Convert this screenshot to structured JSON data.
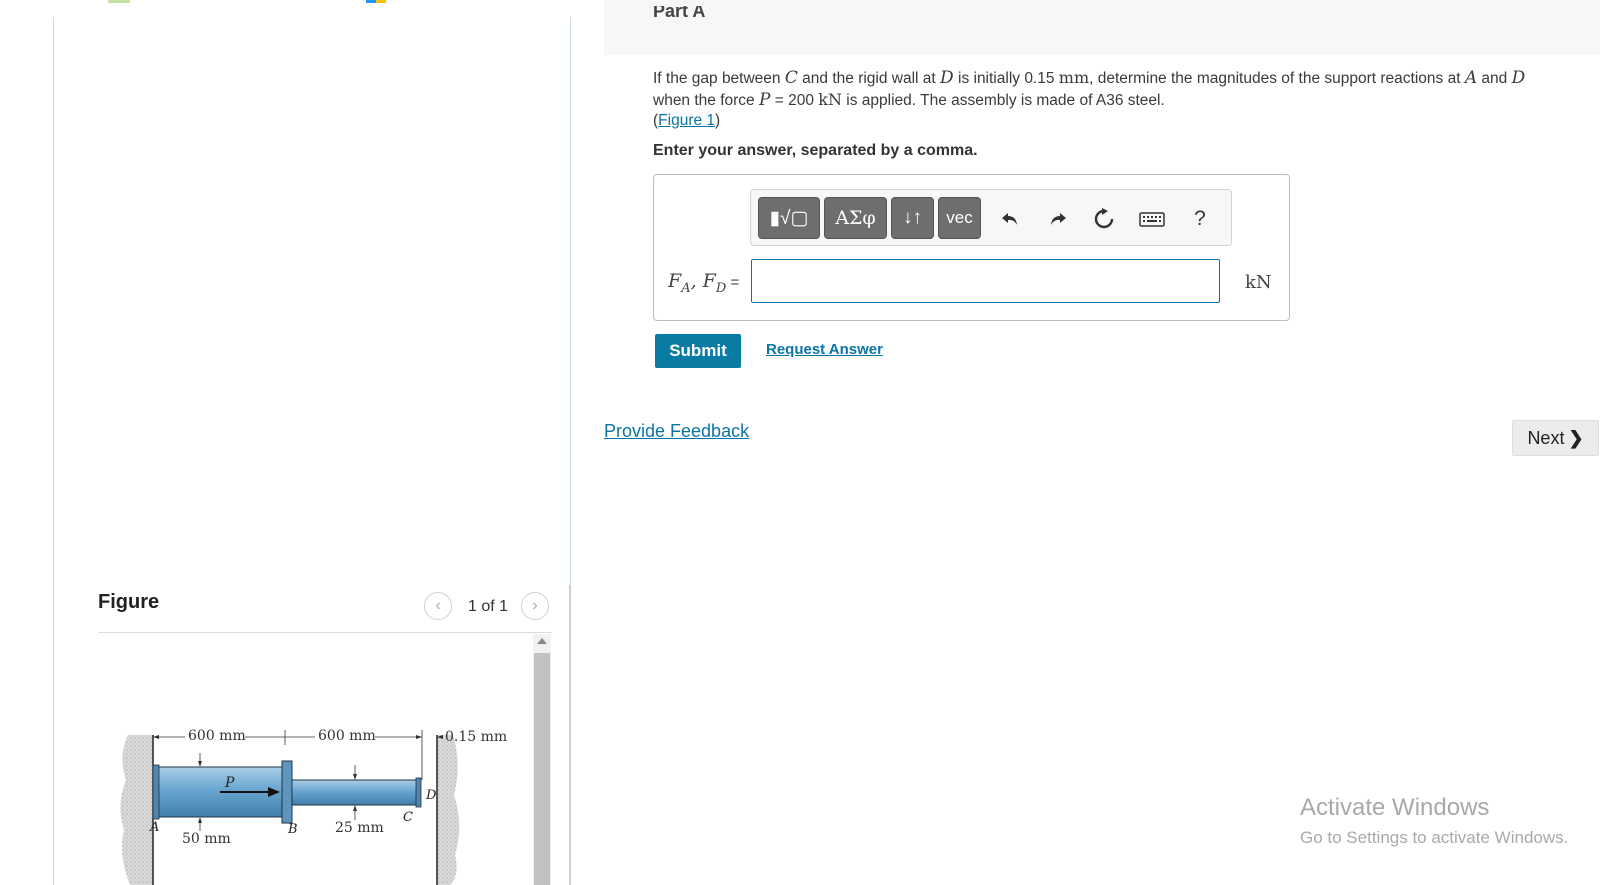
{
  "part": {
    "label": "Part A"
  },
  "problem": {
    "t1": "If the gap between ",
    "v_c": "C",
    "t2": " and the rigid wall at ",
    "v_d": "D",
    "t3": " is initially 0.15 ",
    "u_mm": "mm",
    "t4": ", determine the magnitudes of the support reactions at ",
    "v_a": "A",
    "t5": " and ",
    "v_d2": "D",
    "t6": " when the force ",
    "v_p": "P",
    "t7": " = 200 ",
    "u_kn": "kN",
    "t8": " is applied. The assembly is made of A36 steel.",
    "fig_open": "(",
    "fig_link": "Figure 1",
    "fig_close": ")"
  },
  "instruction": "Enter your answer, separated by a comma.",
  "toolbar": {
    "templates": "▮√▢",
    "greek": "ΑΣφ",
    "arrows": "↓↑",
    "vec": "vec",
    "undo_icon": "undo-icon",
    "redo_icon": "redo-icon",
    "reset_icon": "reset-icon",
    "keyboard_icon": "keyboard-icon",
    "help": "?"
  },
  "answer": {
    "var_f1": "F",
    "sub_a": "A",
    "sep": ", ",
    "var_f2": "F",
    "sub_d": "D",
    "eq": " =",
    "value": "",
    "unit": "kN"
  },
  "actions": {
    "submit": "Submit",
    "request": "Request Answer",
    "feedback": "Provide Feedback",
    "next": "Next",
    "next_chevron": "❯"
  },
  "figure": {
    "title": "Figure",
    "prev": "‹",
    "next": "›",
    "counter": "1 of 1",
    "labels": {
      "dim1": "600 mm",
      "dim2": "600 mm",
      "gap": "0.15 mm",
      "d1": "50 mm",
      "d2": "25 mm",
      "force": "P",
      "pt_a": "A",
      "pt_b": "B",
      "pt_c": "C",
      "pt_d": "D"
    }
  },
  "watermark": {
    "title": "Activate Windows",
    "subtitle": "Go to Settings to activate Windows."
  },
  "colors": {
    "accent": "#0a7ba3",
    "link": "#0b74a6",
    "steel": "#6aa6cf"
  }
}
